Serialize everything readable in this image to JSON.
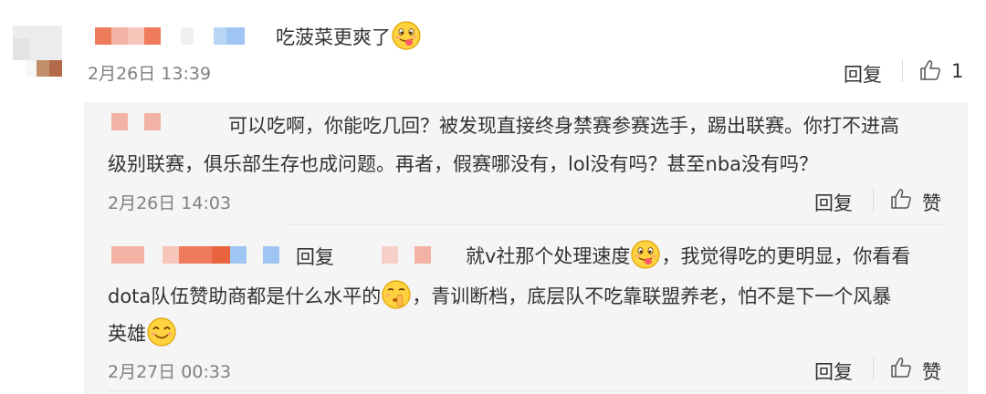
{
  "comment": {
    "text": "吃菠菜更爽了",
    "time": "2月26日 13:39",
    "reply_label": "回复",
    "like_count": "1"
  },
  "replies": [
    {
      "line1": "可以吃啊，你能吃几回？被发现直接终身禁赛参赛选手，踢出联赛。你打不进高",
      "line2": "级别联赛，俱乐部生存也成问题。再者，假赛哪没有，lol没有吗？甚至nba没有吗？",
      "time": "2月26日 14:03",
      "reply_label": "回复",
      "like_label": "赞"
    },
    {
      "prefix": "回复",
      "line1_tail": "就v社那个处理速度",
      "line1_end": "，我觉得吃的更明显，你看看",
      "line2_a": "dota队伍赞助商都是什么水平的",
      "line2_b": "，青训断档，底层队不吃靠联盟养老，怕不是下一个风暴",
      "line3": "英雄",
      "time": "2月27日 00:33",
      "reply_label": "回复",
      "like_label": "赞"
    }
  ],
  "icons": {
    "emoji_tongue": "tongue-emoji",
    "emoji_shush": "shush-emoji",
    "emoji_smile": "smile-emoji",
    "like": "thumbs-up-icon"
  },
  "colors": {
    "redact_orange": "#ee7b5c",
    "redact_pink": "#f3b3a4",
    "redact_blue": "#9fc6f2",
    "reply_bg": "#f5f5f5"
  }
}
